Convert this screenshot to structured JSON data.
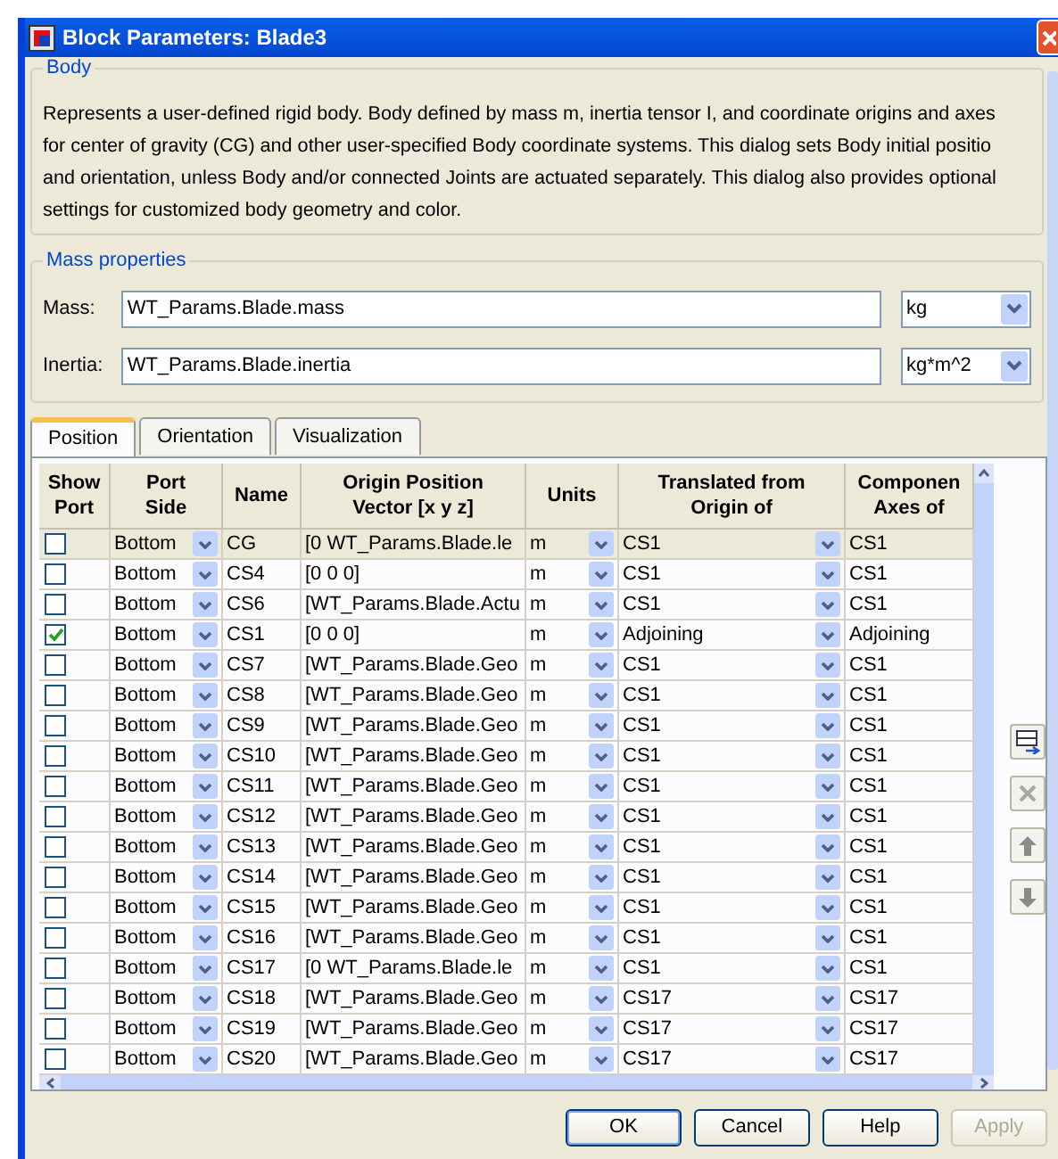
{
  "window": {
    "title": "Block Parameters: Blade3"
  },
  "body_group": {
    "title": "Body",
    "description": "Represents a user-defined rigid body. Body defined by mass m, inertia tensor I, and coordinate origins and axes\nfor center of gravity (CG) and other user-specified Body coordinate systems. This dialog sets Body initial positio\nand orientation, unless Body and/or connected Joints are actuated separately. This dialog also provides optional\nsettings for customized body geometry and color."
  },
  "mass_properties": {
    "title": "Mass properties",
    "fields": [
      {
        "label": "Mass:",
        "value": "WT_Params.Blade.mass",
        "unit": "kg"
      },
      {
        "label": "Inertia:",
        "value": "WT_Params.Blade.inertia",
        "unit": "kg*m^2"
      }
    ]
  },
  "tabs": [
    {
      "label": "Position",
      "selected": true
    },
    {
      "label": "Orientation",
      "selected": false
    },
    {
      "label": "Visualization",
      "selected": false
    }
  ],
  "table": {
    "columns": [
      "Show\nPort",
      "Port\nSide",
      "Name",
      "Origin Position\nVector [x y z]",
      "Units",
      "Translated from\nOrigin of",
      "Componen\nAxes of"
    ],
    "rows": [
      {
        "show_port": false,
        "port_side": "Bottom",
        "name": "CG",
        "origin": "[0 WT_Params.Blade.le",
        "units": "m",
        "translated_from": "CS1",
        "component_axes": "CS1",
        "selected": true
      },
      {
        "show_port": false,
        "port_side": "Bottom",
        "name": "CS4",
        "origin": "[0 0 0]",
        "units": "m",
        "translated_from": "CS1",
        "component_axes": "CS1",
        "selected": false
      },
      {
        "show_port": false,
        "port_side": "Bottom",
        "name": "CS6",
        "origin": "[WT_Params.Blade.Actu",
        "units": "m",
        "translated_from": "CS1",
        "component_axes": "CS1",
        "selected": false
      },
      {
        "show_port": true,
        "port_side": "Bottom",
        "name": "CS1",
        "origin": "[0 0 0]",
        "units": "m",
        "translated_from": "Adjoining",
        "component_axes": "Adjoining",
        "selected": false
      },
      {
        "show_port": false,
        "port_side": "Bottom",
        "name": "CS7",
        "origin": "[WT_Params.Blade.Geo",
        "units": "m",
        "translated_from": "CS1",
        "component_axes": "CS1",
        "selected": false
      },
      {
        "show_port": false,
        "port_side": "Bottom",
        "name": "CS8",
        "origin": "[WT_Params.Blade.Geo",
        "units": "m",
        "translated_from": "CS1",
        "component_axes": "CS1",
        "selected": false
      },
      {
        "show_port": false,
        "port_side": "Bottom",
        "name": "CS9",
        "origin": "[WT_Params.Blade.Geo",
        "units": "m",
        "translated_from": "CS1",
        "component_axes": "CS1",
        "selected": false
      },
      {
        "show_port": false,
        "port_side": "Bottom",
        "name": "CS10",
        "origin": "[WT_Params.Blade.Geo",
        "units": "m",
        "translated_from": "CS1",
        "component_axes": "CS1",
        "selected": false
      },
      {
        "show_port": false,
        "port_side": "Bottom",
        "name": "CS11",
        "origin": "[WT_Params.Blade.Geo",
        "units": "m",
        "translated_from": "CS1",
        "component_axes": "CS1",
        "selected": false
      },
      {
        "show_port": false,
        "port_side": "Bottom",
        "name": "CS12",
        "origin": "[WT_Params.Blade.Geo",
        "units": "m",
        "translated_from": "CS1",
        "component_axes": "CS1",
        "selected": false
      },
      {
        "show_port": false,
        "port_side": "Bottom",
        "name": "CS13",
        "origin": "[WT_Params.Blade.Geo",
        "units": "m",
        "translated_from": "CS1",
        "component_axes": "CS1",
        "selected": false
      },
      {
        "show_port": false,
        "port_side": "Bottom",
        "name": "CS14",
        "origin": "[WT_Params.Blade.Geo",
        "units": "m",
        "translated_from": "CS1",
        "component_axes": "CS1",
        "selected": false
      },
      {
        "show_port": false,
        "port_side": "Bottom",
        "name": "CS15",
        "origin": "[WT_Params.Blade.Geo",
        "units": "m",
        "translated_from": "CS1",
        "component_axes": "CS1",
        "selected": false
      },
      {
        "show_port": false,
        "port_side": "Bottom",
        "name": "CS16",
        "origin": "[WT_Params.Blade.Geo",
        "units": "m",
        "translated_from": "CS1",
        "component_axes": "CS1",
        "selected": false
      },
      {
        "show_port": false,
        "port_side": "Bottom",
        "name": "CS17",
        "origin": "[0 WT_Params.Blade.le",
        "units": "m",
        "translated_from": "CS1",
        "component_axes": "CS1",
        "selected": false
      },
      {
        "show_port": false,
        "port_side": "Bottom",
        "name": "CS18",
        "origin": "[WT_Params.Blade.Geo",
        "units": "m",
        "translated_from": "CS17",
        "component_axes": "CS17",
        "selected": false
      },
      {
        "show_port": false,
        "port_side": "Bottom",
        "name": "CS19",
        "origin": "[WT_Params.Blade.Geo",
        "units": "m",
        "translated_from": "CS17",
        "component_axes": "CS17",
        "selected": false
      },
      {
        "show_port": false,
        "port_side": "Bottom",
        "name": "CS20",
        "origin": "[WT_Params.Blade.Geo",
        "units": "m",
        "translated_from": "CS17",
        "component_axes": "CS17",
        "selected": false
      }
    ]
  },
  "buttons": [
    {
      "label": "OK",
      "disabled": false,
      "default": true
    },
    {
      "label": "Cancel",
      "disabled": false,
      "default": false
    },
    {
      "label": "Help",
      "disabled": false,
      "default": false
    },
    {
      "label": "Apply",
      "disabled": true,
      "default": false
    }
  ]
}
